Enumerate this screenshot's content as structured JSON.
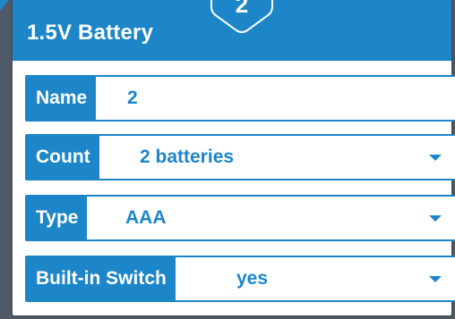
{
  "panel": {
    "title": "1.5V Battery",
    "tab_number": "2"
  },
  "fields": {
    "name": {
      "label": "Name",
      "value": "2"
    },
    "count": {
      "label": "Count",
      "value": "2 batteries"
    },
    "type": {
      "label": "Type",
      "value": "AAA"
    },
    "switch": {
      "label": "Built-in Switch",
      "value": "yes"
    }
  },
  "icons": {
    "dropdown": "chevron-down-icon"
  },
  "colors": {
    "accent": "#1c86c8",
    "background": "#ffffff"
  }
}
